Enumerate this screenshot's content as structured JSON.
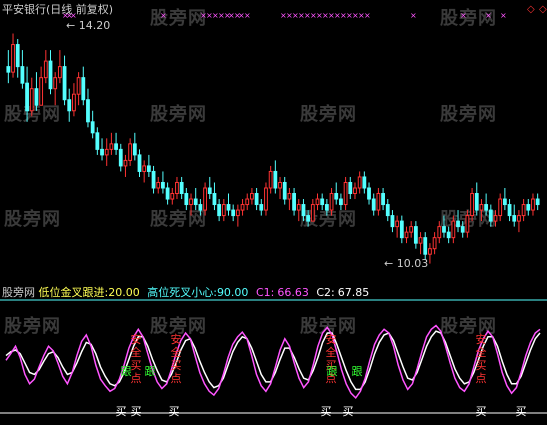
{
  "title": "平安银行(日线 前复权)",
  "watermark": "股旁网",
  "price_high_label": "14.20",
  "price_low_label": "10.03",
  "indicator": {
    "name": "股旁网",
    "golden_label": "低位金叉跟进:",
    "golden_value": "20.00",
    "death_label": "高位死叉小心:",
    "death_value": "90.00",
    "c1_label": "C1:",
    "c1_value": "66.63",
    "c2_label": "C2:",
    "c2_value": "67.85"
  },
  "signals": {
    "safe": "安全买点",
    "follow": "跟",
    "buy": "买"
  },
  "colors": {
    "up": "#ff3333",
    "down": "#54ffff",
    "title": "#cccccc",
    "c1": "#ff55ff",
    "c2": "#ffffff",
    "golden": "#ffff55",
    "death": "#54ffff",
    "safe": "#ff3333",
    "follow": "#33ff33",
    "buy": "#ffffff",
    "divider": "#54ffff"
  },
  "candles": [
    [
      13.6,
      13.9,
      13.3,
      13.5
    ],
    [
      13.5,
      14.2,
      13.4,
      14.0
    ],
    [
      14.0,
      14.1,
      13.4,
      13.6
    ],
    [
      13.6,
      13.9,
      13.2,
      13.3
    ],
    [
      13.3,
      13.6,
      12.6,
      12.8
    ],
    [
      12.8,
      13.4,
      12.7,
      13.2
    ],
    [
      13.2,
      13.5,
      12.8,
      12.9
    ],
    [
      12.9,
      13.6,
      12.9,
      13.4
    ],
    [
      13.4,
      13.9,
      13.3,
      13.7
    ],
    [
      13.7,
      13.9,
      13.1,
      13.2
    ],
    [
      13.2,
      13.5,
      12.9,
      13.4
    ],
    [
      13.4,
      13.9,
      13.3,
      13.6
    ],
    [
      13.6,
      13.8,
      12.9,
      13.0
    ],
    [
      13.0,
      13.2,
      12.6,
      12.8
    ],
    [
      12.8,
      13.3,
      12.7,
      13.1
    ],
    [
      13.1,
      13.5,
      12.9,
      13.4
    ],
    [
      13.4,
      13.6,
      12.9,
      13.0
    ],
    [
      13.0,
      13.2,
      12.5,
      12.6
    ],
    [
      12.6,
      12.8,
      12.3,
      12.4
    ],
    [
      12.4,
      12.5,
      12.0,
      12.1
    ],
    [
      12.1,
      12.3,
      11.9,
      12.0
    ],
    [
      12.0,
      12.3,
      11.8,
      12.1
    ],
    [
      12.1,
      12.4,
      12.0,
      12.2
    ],
    [
      12.2,
      12.4,
      12.0,
      12.1
    ],
    [
      12.1,
      12.2,
      11.7,
      11.8
    ],
    [
      11.8,
      12.0,
      11.6,
      11.9
    ],
    [
      11.9,
      12.3,
      11.8,
      12.2
    ],
    [
      12.2,
      12.4,
      11.9,
      12.0
    ],
    [
      12.0,
      12.1,
      11.6,
      11.7
    ],
    [
      11.7,
      11.9,
      11.5,
      11.8
    ],
    [
      11.8,
      12.0,
      11.6,
      11.7
    ],
    [
      11.7,
      11.8,
      11.3,
      11.4
    ],
    [
      11.4,
      11.6,
      11.3,
      11.5
    ],
    [
      11.5,
      11.7,
      11.3,
      11.4
    ],
    [
      11.4,
      11.5,
      11.1,
      11.2
    ],
    [
      11.2,
      11.4,
      11.1,
      11.3
    ],
    [
      11.3,
      11.6,
      11.2,
      11.5
    ],
    [
      11.5,
      11.6,
      11.2,
      11.3
    ],
    [
      11.3,
      11.4,
      11.0,
      11.1
    ],
    [
      11.1,
      11.3,
      10.9,
      11.2
    ],
    [
      11.2,
      11.4,
      11.0,
      11.1
    ],
    [
      11.1,
      11.2,
      10.9,
      11.0
    ],
    [
      11.0,
      11.5,
      10.9,
      11.4
    ],
    [
      11.4,
      11.6,
      11.2,
      11.3
    ],
    [
      11.3,
      11.5,
      11.0,
      11.1
    ],
    [
      11.1,
      11.2,
      10.8,
      10.9
    ],
    [
      10.9,
      11.2,
      10.8,
      11.1
    ],
    [
      11.1,
      11.3,
      10.9,
      11.0
    ],
    [
      11.0,
      11.1,
      10.8,
      10.9
    ],
    [
      10.9,
      11.1,
      10.7,
      11.0
    ],
    [
      11.0,
      11.2,
      10.9,
      11.1
    ],
    [
      11.1,
      11.3,
      11.0,
      11.2
    ],
    [
      11.2,
      11.4,
      11.1,
      11.3
    ],
    [
      11.3,
      11.4,
      11.0,
      11.1
    ],
    [
      11.1,
      11.2,
      10.9,
      11.0
    ],
    [
      11.0,
      11.5,
      10.9,
      11.4
    ],
    [
      11.4,
      11.8,
      11.3,
      11.7
    ],
    [
      11.7,
      11.9,
      11.3,
      11.4
    ],
    [
      11.4,
      11.6,
      11.2,
      11.5
    ],
    [
      11.5,
      11.6,
      11.1,
      11.2
    ],
    [
      11.2,
      11.4,
      11.0,
      11.3
    ],
    [
      11.3,
      11.4,
      10.9,
      11.0
    ],
    [
      11.0,
      11.2,
      10.8,
      11.1
    ],
    [
      11.1,
      11.2,
      10.8,
      10.9
    ],
    [
      10.9,
      11.0,
      10.7,
      10.8
    ],
    [
      10.8,
      11.2,
      10.8,
      11.1
    ],
    [
      11.1,
      11.3,
      11.0,
      11.2
    ],
    [
      11.2,
      11.3,
      11.0,
      11.1
    ],
    [
      11.1,
      11.2,
      10.9,
      11.0
    ],
    [
      11.0,
      11.4,
      10.9,
      11.3
    ],
    [
      11.3,
      11.5,
      11.1,
      11.2
    ],
    [
      11.2,
      11.3,
      11.0,
      11.1
    ],
    [
      11.1,
      11.6,
      11.0,
      11.5
    ],
    [
      11.5,
      11.6,
      11.2,
      11.3
    ],
    [
      11.3,
      11.5,
      11.2,
      11.4
    ],
    [
      11.4,
      11.7,
      11.3,
      11.6
    ],
    [
      11.6,
      11.7,
      11.3,
      11.4
    ],
    [
      11.4,
      11.5,
      11.1,
      11.2
    ],
    [
      11.2,
      11.3,
      10.9,
      11.0
    ],
    [
      11.0,
      11.4,
      10.9,
      11.3
    ],
    [
      11.3,
      11.4,
      11.0,
      11.1
    ],
    [
      11.1,
      11.2,
      10.8,
      10.9
    ],
    [
      10.9,
      11.0,
      10.6,
      10.7
    ],
    [
      10.7,
      10.9,
      10.5,
      10.8
    ],
    [
      10.8,
      10.9,
      10.4,
      10.5
    ],
    [
      10.5,
      10.7,
      10.4,
      10.6
    ],
    [
      10.6,
      10.8,
      10.5,
      10.7
    ],
    [
      10.7,
      10.8,
      10.3,
      10.4
    ],
    [
      10.4,
      10.6,
      10.2,
      10.5
    ],
    [
      10.5,
      10.6,
      10.1,
      10.2
    ],
    [
      10.2,
      10.4,
      10.03,
      10.3
    ],
    [
      10.3,
      10.6,
      10.2,
      10.5
    ],
    [
      10.5,
      10.8,
      10.4,
      10.7
    ],
    [
      10.7,
      10.9,
      10.5,
      10.6
    ],
    [
      10.6,
      10.7,
      10.4,
      10.5
    ],
    [
      10.5,
      10.9,
      10.4,
      10.8
    ],
    [
      10.8,
      11.0,
      10.6,
      10.7
    ],
    [
      10.7,
      10.8,
      10.5,
      10.6
    ],
    [
      10.6,
      11.0,
      10.5,
      10.9
    ],
    [
      10.9,
      11.4,
      10.8,
      11.3
    ],
    [
      11.3,
      11.5,
      10.9,
      11.0
    ],
    [
      11.0,
      11.2,
      10.8,
      11.1
    ],
    [
      11.1,
      11.3,
      10.9,
      11.0
    ],
    [
      11.0,
      11.1,
      10.7,
      10.8
    ],
    [
      10.8,
      11.0,
      10.7,
      10.9
    ],
    [
      10.9,
      11.3,
      10.8,
      11.2
    ],
    [
      11.2,
      11.4,
      11.0,
      11.1
    ],
    [
      11.1,
      11.2,
      10.8,
      10.9
    ],
    [
      10.9,
      11.1,
      10.7,
      10.8
    ],
    [
      10.8,
      11.0,
      10.6,
      10.9
    ],
    [
      10.9,
      11.2,
      10.8,
      11.1
    ],
    [
      11.1,
      11.2,
      10.9,
      11.0
    ],
    [
      11.0,
      11.3,
      10.9,
      11.2
    ],
    [
      11.2,
      11.3,
      11.0,
      11.1
    ]
  ],
  "c1_series": [
    55,
    62,
    70,
    58,
    40,
    30,
    35,
    48,
    60,
    70,
    65,
    52,
    38,
    30,
    42,
    60,
    75,
    82,
    70,
    50,
    35,
    28,
    22,
    25,
    35,
    50,
    68,
    80,
    88,
    80,
    62,
    45,
    32,
    25,
    30,
    45,
    62,
    76,
    84,
    78,
    60,
    42,
    30,
    22,
    18,
    25,
    40,
    58,
    72,
    80,
    85,
    78,
    60,
    40,
    28,
    22,
    30,
    48,
    66,
    78,
    70,
    52,
    36,
    26,
    32,
    50,
    70,
    84,
    90,
    82,
    64,
    45,
    30,
    20,
    15,
    22,
    36,
    55,
    72,
    82,
    88,
    84,
    70,
    50,
    34,
    24,
    30,
    46,
    64,
    80,
    88,
    92,
    86,
    70,
    52,
    36,
    26,
    22,
    30,
    48,
    66,
    78,
    86,
    80,
    62,
    42,
    28,
    20,
    26,
    42,
    60,
    74,
    84,
    88
  ],
  "c2_series": [
    60,
    64,
    66,
    62,
    52,
    42,
    40,
    45,
    54,
    62,
    64,
    58,
    48,
    40,
    42,
    52,
    64,
    74,
    72,
    62,
    48,
    38,
    30,
    28,
    32,
    42,
    56,
    70,
    80,
    80,
    70,
    56,
    44,
    34,
    32,
    40,
    52,
    66,
    76,
    78,
    68,
    54,
    42,
    32,
    26,
    28,
    36,
    50,
    64,
    74,
    80,
    78,
    68,
    54,
    40,
    32,
    32,
    42,
    56,
    68,
    68,
    58,
    46,
    36,
    34,
    44,
    58,
    74,
    84,
    84,
    72,
    58,
    44,
    32,
    24,
    24,
    32,
    46,
    62,
    74,
    82,
    84,
    76,
    62,
    48,
    36,
    34,
    42,
    56,
    70,
    80,
    86,
    84,
    74,
    60,
    46,
    36,
    30,
    32,
    42,
    56,
    70,
    80,
    80,
    70,
    54,
    40,
    30,
    30,
    38,
    52,
    66,
    78,
    84
  ]
}
